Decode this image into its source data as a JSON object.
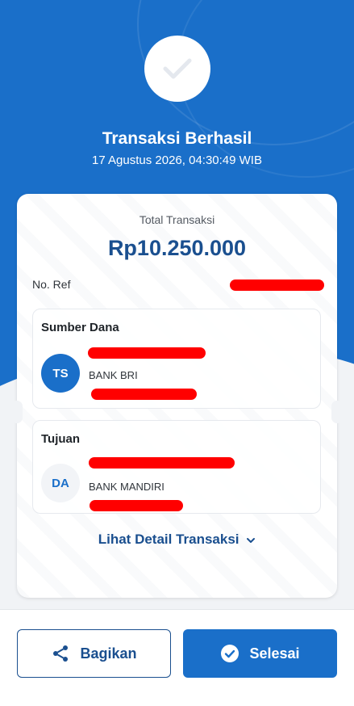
{
  "header": {
    "title": "Transaksi Berhasil",
    "datetime": "17 Agustus 2026, 04:30:49 WIB",
    "check_icon": "check-icon"
  },
  "summary": {
    "total_label": "Total Transaksi",
    "total_amount": "Rp10.250.000",
    "ref_label": "No. Ref"
  },
  "source": {
    "title": "Sumber Dana",
    "initials": "TS",
    "bank": "BANK BRI"
  },
  "destination": {
    "title": "Tujuan",
    "initials": "DA",
    "bank": "BANK MANDIRI"
  },
  "detail_link": {
    "label": "Lihat Detail Transaksi",
    "icon": "chevron-down-icon"
  },
  "actions": {
    "share_label": "Bagikan",
    "share_icon": "share-icon",
    "done_label": "Selesai",
    "done_icon": "check-circle-icon"
  },
  "colors": {
    "primary": "#1a6fc9",
    "primary_dark": "#1a4f8f",
    "redaction": "#ff0000"
  }
}
